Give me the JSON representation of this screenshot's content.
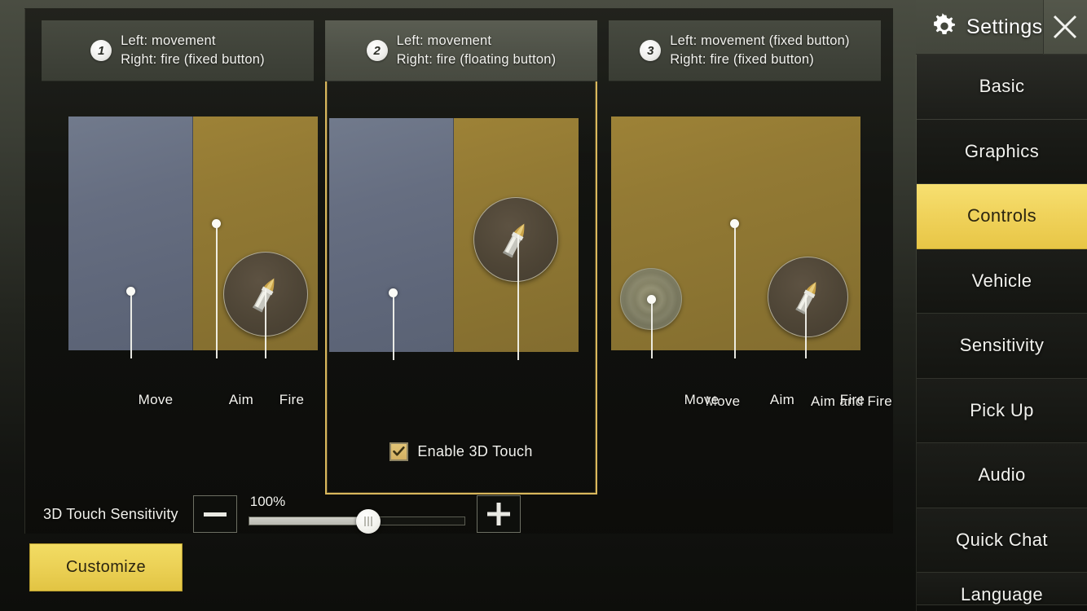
{
  "sidebar": {
    "title": "Settings",
    "gear_icon": "gear-icon",
    "close_icon": "close-x-icon",
    "items": [
      {
        "label": "Basic",
        "active": false
      },
      {
        "label": "Graphics",
        "active": false
      },
      {
        "label": "Controls",
        "active": true
      },
      {
        "label": "Vehicle",
        "active": false
      },
      {
        "label": "Sensitivity",
        "active": false
      },
      {
        "label": "Pick Up",
        "active": false
      },
      {
        "label": "Audio",
        "active": false
      },
      {
        "label": "Quick Chat",
        "active": false
      },
      {
        "label": "Language",
        "active": false
      }
    ]
  },
  "cards": [
    {
      "badge": "1",
      "line1": "Left: movement",
      "line2": "Right: fire (fixed button)",
      "selected": false,
      "labels": [
        "Move",
        "Aim",
        "Fire"
      ]
    },
    {
      "badge": "2",
      "line1": "Left: movement",
      "line2": "Right: fire (floating button)",
      "selected": true,
      "labels": [
        "Move",
        "Aim and Fire"
      ],
      "checkbox": {
        "label": "Enable 3D Touch",
        "checked": true
      }
    },
    {
      "badge": "3",
      "line1": "Left: movement (fixed button)",
      "line2": "Right: fire (fixed button)",
      "selected": false,
      "labels": [
        "Move",
        "Aim",
        "Fire"
      ]
    }
  ],
  "sensitivity": {
    "label": "3D Touch Sensitivity",
    "value_text": "100%",
    "value": 100,
    "fill_percent": 55,
    "minus_label": "minus-icon",
    "plus_label": "plus-icon"
  },
  "customize": {
    "label": "Customize"
  },
  "colors": {
    "accent_yellow": "#ecd257",
    "selected_border": "#d9b75c",
    "panel_bg": "#14150f",
    "preview_blue": "#666e81",
    "preview_gold": "#937a34"
  }
}
